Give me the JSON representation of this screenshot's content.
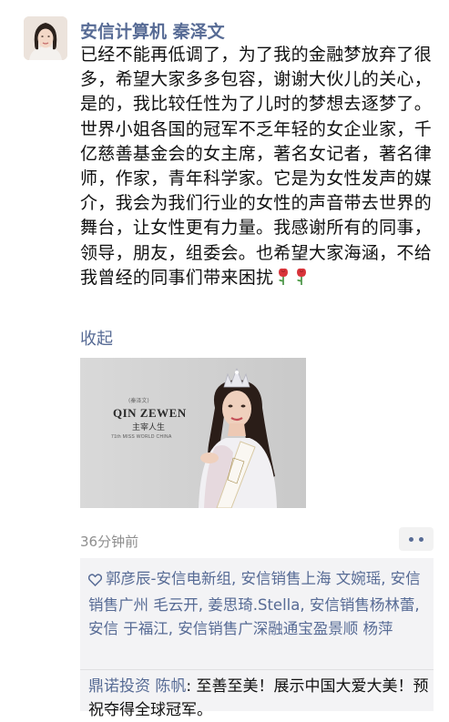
{
  "post": {
    "author": "安信计算机 秦泽文",
    "text": "已经不能再低调了，为了我的金融梦放弃了很多，希望大家多多包容，谢谢大伙儿的关心，是的，我比较任性为了儿时的梦想去逐梦了。世界小姐各国的冠军不乏年轻的女企业家，千亿慈善基金会的女主席，著名女记者，著名律师，作家，青年科学家。它是为女性发声的媒介，我会为我们行业的女性的声音带去世界的舞台，让女性更有力量。我感谢所有的同事，领导，朋友，组委会。也希望大家海涵，不给我曾经的同事们带来困扰",
    "emoji_icons": [
      "rose-icon",
      "rose-icon"
    ],
    "collapse_label": "收起",
    "photo": {
      "name": "QIN ZEWEN",
      "tag": "(秦泽文)",
      "subtitle": "主宰人生",
      "caption": "71th MISS WORLD CHINA"
    },
    "time": "36分钟前",
    "more_icon": "more-dots-icon"
  },
  "likes": {
    "icon": "heart-icon",
    "names": "郭彦辰-安信电新组, 安信销售上海 文婉瑶, 安信销售广州 毛云开, 姜思琦.Stella, 安信销售杨林蕾, 安信 于福江, 安信销售广深融通宝盈景顺 杨萍"
  },
  "comments": [
    {
      "author": "鼎诺投资 陈帆",
      "separator": ": ",
      "text": "至善至美！展示中国大爱大美！预祝夺得全球冠军。"
    }
  ],
  "colors": {
    "link": "#576b95",
    "text": "#111111",
    "meta": "#8e8e8e",
    "likes_bg": "#f3f3f5"
  }
}
